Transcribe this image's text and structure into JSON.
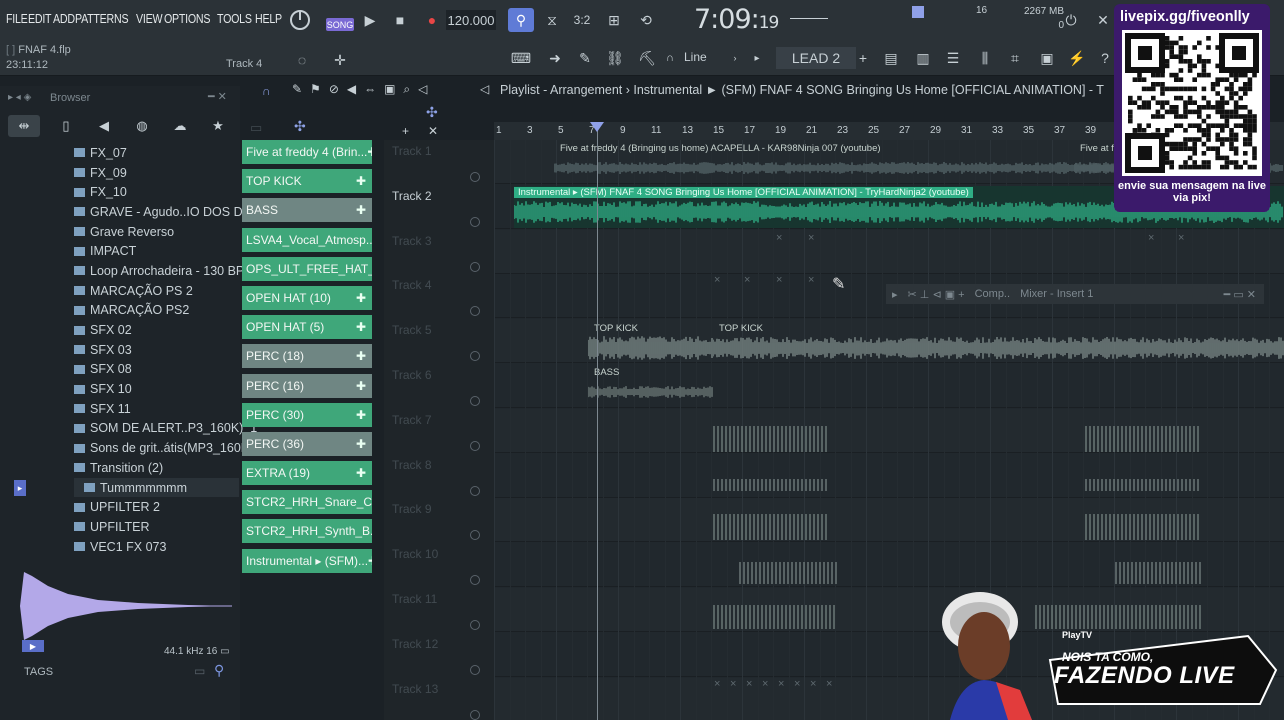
{
  "menus": [
    "FILE",
    "EDIT",
    "ADD",
    "PATTERNS",
    "VIEW",
    "OPTIONS",
    "TOOLS",
    "HELP"
  ],
  "transport": {
    "song_mode_label": "SONG",
    "tempo": "120.000",
    "time_main": "7:09:",
    "time_sub": "19",
    "cpu_value": "16",
    "memory": "2267 MB",
    "memory_sub": "0"
  },
  "project": {
    "file_name": "FNAF 4.flp",
    "elapsed": "23:11:12",
    "hint_track": "Track 4"
  },
  "toolbar2": {
    "snap": "Line",
    "pattern": "LEAD 2"
  },
  "browser": {
    "title": "Browser",
    "items": [
      {
        "label": "FX_07",
        "sub": false
      },
      {
        "label": "FX_09",
        "sub": false
      },
      {
        "label": "FX_10",
        "sub": false
      },
      {
        "label": "GRAVE - Agudo..IO DOS DJS ]",
        "sub": false
      },
      {
        "label": "Grave Reverso",
        "sub": false
      },
      {
        "label": "IMPACT",
        "sub": false
      },
      {
        "label": "Loop Arrochadeira - 130 BPM",
        "sub": false
      },
      {
        "label": "MARCAÇÃO PS 2",
        "sub": false
      },
      {
        "label": "MARCAÇÃO PS2",
        "sub": false
      },
      {
        "label": "SFX 02",
        "sub": false
      },
      {
        "label": "SFX 03",
        "sub": false
      },
      {
        "label": "SFX 08",
        "sub": false
      },
      {
        "label": "SFX 10",
        "sub": false
      },
      {
        "label": "SFX 11",
        "sub": false
      },
      {
        "label": "SOM DE ALERT..P3_160K)_1",
        "sub": false
      },
      {
        "label": "Sons de grit..átis(MP3_160K)",
        "sub": false
      },
      {
        "label": "Transition  (2)",
        "sub": false
      },
      {
        "label": "Tummmmmmm",
        "sub": true
      },
      {
        "label": "UPFILTER 2",
        "sub": false
      },
      {
        "label": "UPFILTER",
        "sub": false
      },
      {
        "label": "VEC1 FX 073",
        "sub": false
      }
    ],
    "sample_info": "44.1 kHz 16",
    "tags_label": "TAGS"
  },
  "picker": [
    {
      "label": "Five at freddy 4 (Brin...",
      "muted": false
    },
    {
      "label": "TOP KICK",
      "muted": false
    },
    {
      "label": "BASS",
      "muted": true
    },
    {
      "label": "LSVA4_Vocal_Atmosp...",
      "muted": false
    },
    {
      "label": "OPS_ULT_FREE_HAT_...",
      "muted": false
    },
    {
      "label": "OPEN HAT (10)",
      "muted": false
    },
    {
      "label": "OPEN HAT (5)",
      "muted": false
    },
    {
      "label": "PERC (18)",
      "muted": true
    },
    {
      "label": "PERC (16)",
      "muted": true
    },
    {
      "label": "PERC (30)",
      "muted": false
    },
    {
      "label": "PERC (36)",
      "muted": true
    },
    {
      "label": "EXTRA (19)",
      "muted": false
    },
    {
      "label": "STCR2_HRH_Snare_C...",
      "muted": false
    },
    {
      "label": "STCR2_HRH_Synth_B...",
      "muted": false
    },
    {
      "label": "Instrumental ▸ (SFM)...",
      "muted": false
    }
  ],
  "playlist": {
    "breadcrumb": "Playlist - Arrangement  ›  Instrumental ► (SFM) FNAF 4 SONG Bringing Us Home [OFFICIAL ANIMATION] - T",
    "ruler": [
      "1",
      "3",
      "5",
      "7",
      "9",
      "11",
      "13",
      "15",
      "17",
      "19",
      "21",
      "23",
      "25",
      "27",
      "29",
      "31",
      "33",
      "35",
      "37",
      "39"
    ],
    "tracks": [
      "Track 1",
      "Track 2",
      "Track 3",
      "Track 4",
      "Track 5",
      "Track 6",
      "Track 7",
      "Track 8",
      "Track 9",
      "Track 10",
      "Track 11",
      "Track 12",
      "Track 13"
    ],
    "clip_acapella": "Five at freddy 4 (Bringing us home) ACAPELLA - KAR98Ninja 007 (youtube)",
    "clip_acapella_2": "Five at fre...",
    "clip_instrumental": "Instrumental ▸ (SFM) FNAF 4 SONG Bringing Us Home [OFFICIAL ANIMATION] - TryHardNinja2 (youtube)",
    "clip_topkick": "TOP KICK",
    "clip_bass": "BASS"
  },
  "mixer_mini": {
    "title": "Comp..",
    "subtitle": "Mixer - Insert 1"
  },
  "overlay": {
    "pix_url": "livepix.gg/fiveonlly",
    "pix_message": "envie sua mensagem na live via pix!",
    "live_tag": "PlayTV",
    "live_top": "NOIS TA COMO,",
    "live_big": "FAZENDO LIVE"
  },
  "colors": {
    "clip_green": "#3fa77a",
    "instrumental_teal": "#3fbf9a",
    "pix_purple": "#3b1a6b"
  }
}
